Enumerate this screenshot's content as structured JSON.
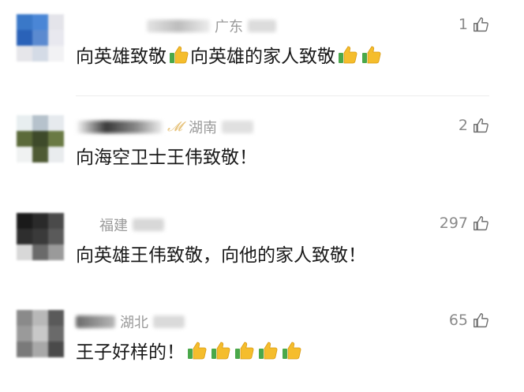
{
  "comments": [
    {
      "region": "广东",
      "likes": "1",
      "text": "向英雄致敬",
      "text2": "向英雄的家人致敬",
      "avatar_colors": [
        "#3a78c8",
        "#4a86d6",
        "#e4e4ea",
        "#2a62b8",
        "#5b8ad0",
        "#e8e8ef",
        "#e6e6ea",
        "#d4dbe6",
        "#f2f2f4"
      ]
    },
    {
      "region": "湖南",
      "likes": "2",
      "text": "向海空卫士王伟致敬！",
      "avatar_colors": [
        "#e8eef0",
        "#b6c2cc",
        "#e6eaee",
        "#5b6a3a",
        "#3e4a2a",
        "#6a7a44",
        "#f0f2f2",
        "#4e5a34",
        "#e9ecee"
      ]
    },
    {
      "region": "福建",
      "likes": "297",
      "text": "向英雄王伟致敬，向他的家人致敬！",
      "avatar_colors": [
        "#1a1a1a",
        "#2a2a2a",
        "#4a4a4a",
        "#2e2e2e",
        "#3a3a3a",
        "#5a5a5a",
        "#d8d8d8",
        "#6a6a6a",
        "#9a9a9a"
      ]
    },
    {
      "region": "湖北",
      "likes": "65",
      "text": "王子好样的！",
      "avatar_colors": [
        "#8a8a8a",
        "#b8b8b8",
        "#5a5a5a",
        "#9a9a9a",
        "#c8c8c8",
        "#6a6a6a",
        "#7a7a7a",
        "#a8a8a8",
        "#4a4a4a"
      ]
    }
  ]
}
